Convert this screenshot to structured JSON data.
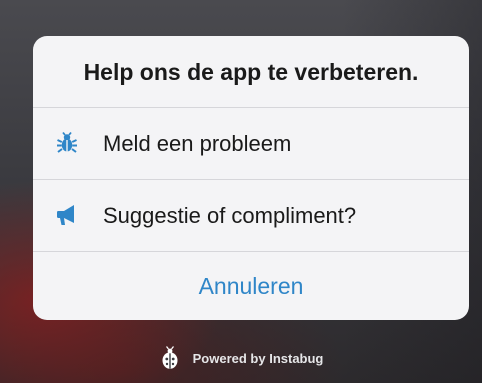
{
  "sheet": {
    "title": "Help ons de app te verbeteren.",
    "options": [
      {
        "label": "Meld een probleem",
        "icon": "bug-icon"
      },
      {
        "label": "Suggestie of compliment?",
        "icon": "megaphone-icon"
      }
    ],
    "cancel_label": "Annuleren"
  },
  "footer": {
    "powered_text": "Powered by Instabug",
    "icon": "instabug-logo-icon"
  },
  "colors": {
    "accent": "#2f86c8",
    "sheet_background": "#f4f4f6",
    "title_text": "#1a1a1a"
  }
}
